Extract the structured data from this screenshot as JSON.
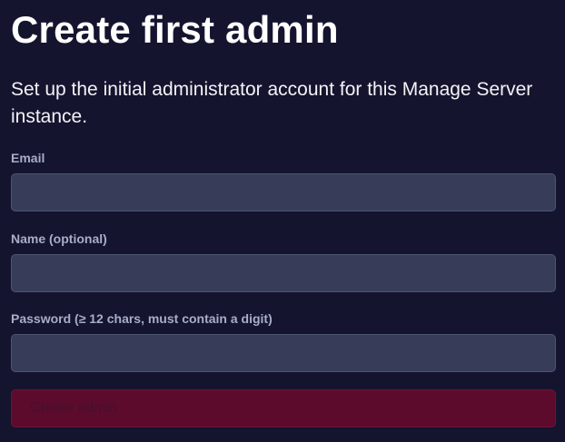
{
  "page": {
    "title": "Create first admin",
    "subtitle": "Set up the initial administrator account for this Manage Server instance."
  },
  "form": {
    "email": {
      "label": "Email",
      "value": "",
      "placeholder": ""
    },
    "name": {
      "label": "Name (optional)",
      "value": "",
      "placeholder": ""
    },
    "password": {
      "label": "Password (≥ 12 chars, must contain a digit)",
      "value": "",
      "placeholder": ""
    },
    "submit_label": "Create admin",
    "submit_disabled": true
  },
  "colors": {
    "background": "#14142e",
    "input_background": "#373d58",
    "button_background": "#5c0b2c",
    "label": "#a9adc8"
  }
}
